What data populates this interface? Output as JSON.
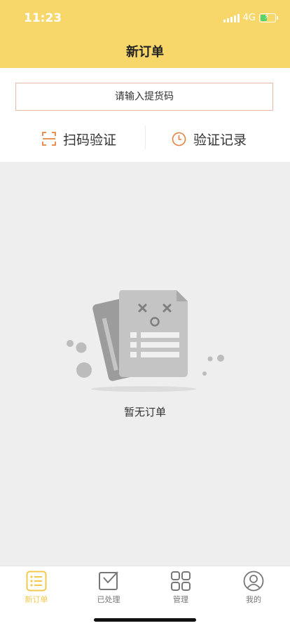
{
  "status_bar": {
    "time": "11:23",
    "network": "4G"
  },
  "header": {
    "title": "新订单"
  },
  "search": {
    "placeholder": "请输入提货码"
  },
  "actions": {
    "scan_label": "扫码验证",
    "record_label": "验证记录"
  },
  "empty_state": {
    "text": "暂无订单"
  },
  "tabbar": {
    "items": [
      {
        "label": "新订单",
        "icon": "order-list-icon",
        "active": true
      },
      {
        "label": "已处理",
        "icon": "processed-check-icon",
        "active": false
      },
      {
        "label": "管理",
        "icon": "grid-icon",
        "active": false
      },
      {
        "label": "我的",
        "icon": "user-icon",
        "active": false
      }
    ]
  },
  "colors": {
    "brand_yellow": "#f8d76a",
    "tab_active": "#f2c94c",
    "accent_orange": "#e8823f",
    "input_border": "#eab7a8",
    "battery_green": "#5ad36a"
  }
}
